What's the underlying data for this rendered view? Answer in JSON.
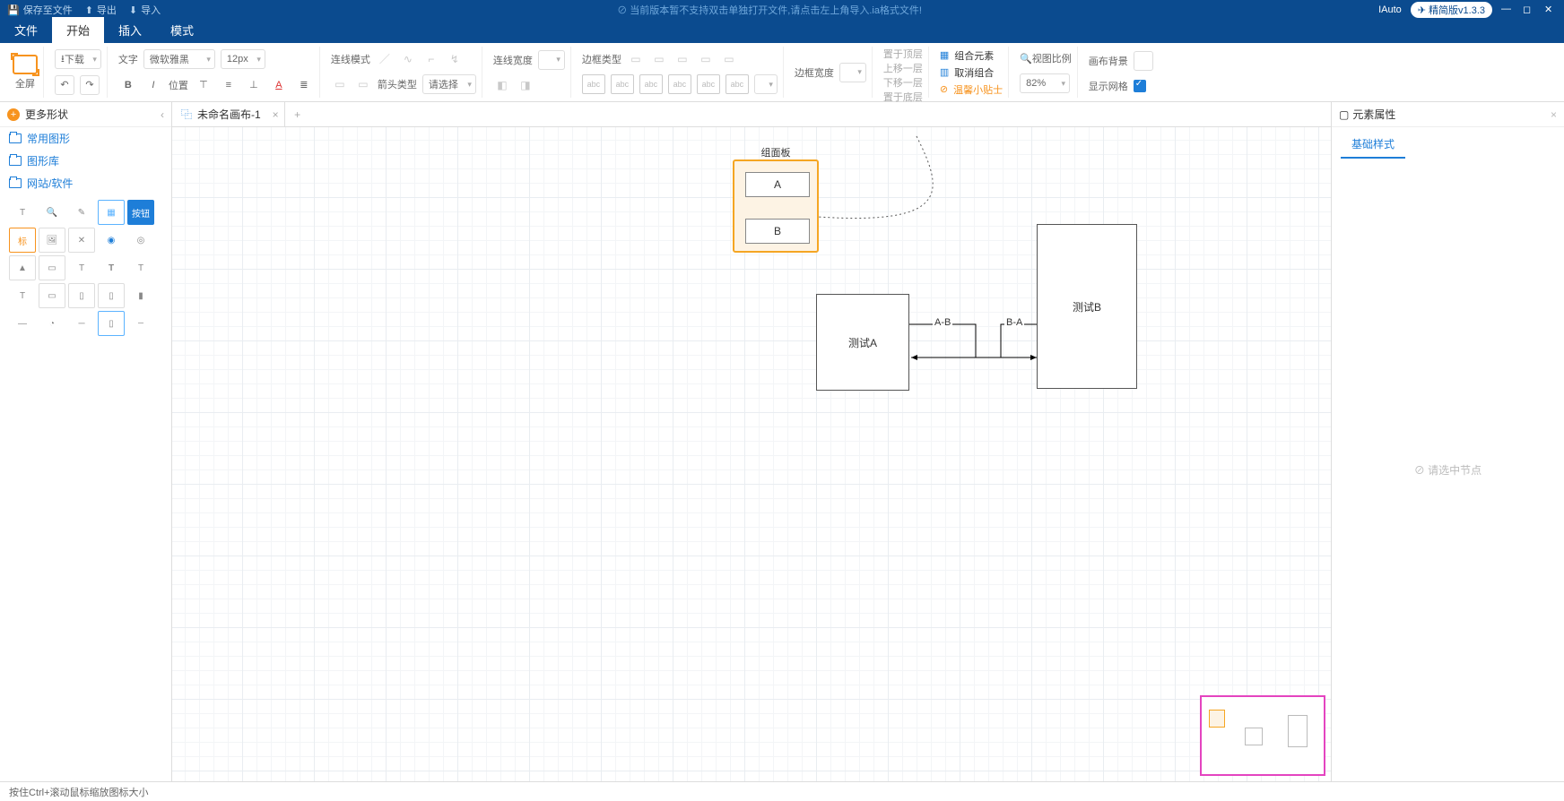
{
  "titlebar": {
    "save": "保存至文件",
    "export": "导出",
    "import": "导入",
    "notice": "⊘ 当前版本暂不支持双击单独打开文件,请点击左上角导入.ia格式文件!",
    "app": "IAuto",
    "version": "精简版v1.3.3"
  },
  "menu": {
    "file": "文件",
    "start": "开始",
    "insert": "插入",
    "mode": "模式"
  },
  "ribbon": {
    "fullscreen": "全屏",
    "download": "下载",
    "text_label": "文字",
    "font": "微软雅黑",
    "font_size": "12px",
    "position": "位置",
    "line_mode": "连线模式",
    "line_width": "连线宽度",
    "arrow_type": "箭头类型",
    "arrow_select": "请选择",
    "border_type": "边框类型",
    "border_width": "边框宽度",
    "z_top": "置于顶层",
    "z_up": "上移一层",
    "z_down": "下移一层",
    "z_bottom": "置于底层",
    "group": "组合元素",
    "ungroup": "取消组合",
    "tip": "温馨小贴士",
    "view_scale": "视图比例",
    "scale_value": "82%",
    "canvas_bg": "画布背景",
    "show_grid": "显示网格"
  },
  "sidebar": {
    "more_shapes": "更多形状",
    "cats": [
      "常用图形",
      "图形库",
      "网站/软件"
    ]
  },
  "tabs": {
    "t1": "未命名画布-1"
  },
  "canvas": {
    "group_title": "组面板",
    "gp_a": "A",
    "gp_b": "B",
    "node_a": "测试A",
    "node_b": "测试B",
    "edge_ab": "A-B",
    "edge_ba": "B-A"
  },
  "rightpanel": {
    "title": "元素属性",
    "tab": "基础样式",
    "empty": "⊘ 请选中节点"
  },
  "status": {
    "hint": "按住Ctrl+滚动鼠标缩放图标大小"
  }
}
